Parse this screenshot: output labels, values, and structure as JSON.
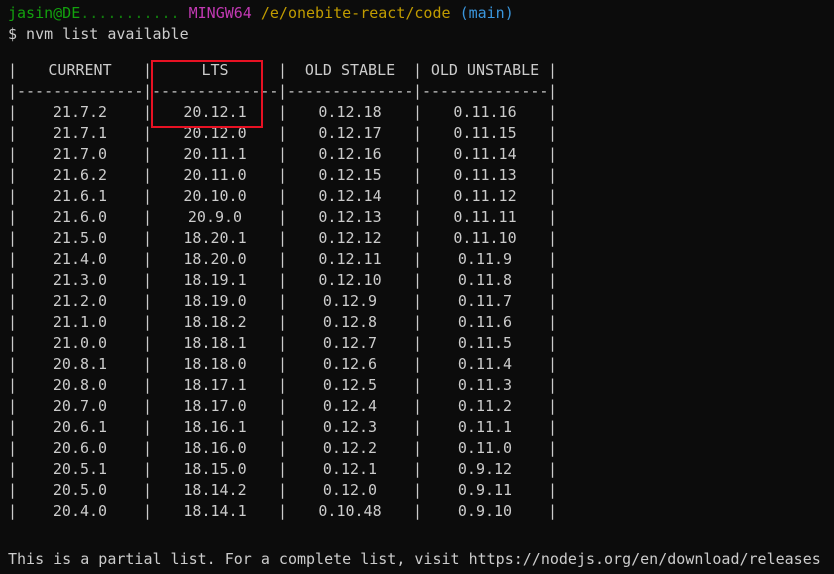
{
  "prompt": {
    "user_host": "jasin@DE",
    "host_obscured": "...........",
    "mingw": "MINGW64",
    "path": "/e/onebite-react/code",
    "branch": "(main)"
  },
  "command": "$ nvm list available",
  "table": {
    "headers": [
      "CURRENT",
      "LTS",
      "OLD STABLE",
      "OLD UNSTABLE"
    ],
    "divider": "--------------",
    "rows": [
      [
        "21.7.2",
        "20.12.1",
        "0.12.18",
        "0.11.16"
      ],
      [
        "21.7.1",
        "20.12.0",
        "0.12.17",
        "0.11.15"
      ],
      [
        "21.7.0",
        "20.11.1",
        "0.12.16",
        "0.11.14"
      ],
      [
        "21.6.2",
        "20.11.0",
        "0.12.15",
        "0.11.13"
      ],
      [
        "21.6.1",
        "20.10.0",
        "0.12.14",
        "0.11.12"
      ],
      [
        "21.6.0",
        "20.9.0",
        "0.12.13",
        "0.11.11"
      ],
      [
        "21.5.0",
        "18.20.1",
        "0.12.12",
        "0.11.10"
      ],
      [
        "21.4.0",
        "18.20.0",
        "0.12.11",
        "0.11.9"
      ],
      [
        "21.3.0",
        "18.19.1",
        "0.12.10",
        "0.11.8"
      ],
      [
        "21.2.0",
        "18.19.0",
        "0.12.9",
        "0.11.7"
      ],
      [
        "21.1.0",
        "18.18.2",
        "0.12.8",
        "0.11.6"
      ],
      [
        "21.0.0",
        "18.18.1",
        "0.12.7",
        "0.11.5"
      ],
      [
        "20.8.1",
        "18.18.0",
        "0.12.6",
        "0.11.4"
      ],
      [
        "20.8.0",
        "18.17.1",
        "0.12.5",
        "0.11.3"
      ],
      [
        "20.7.0",
        "18.17.0",
        "0.12.4",
        "0.11.2"
      ],
      [
        "20.6.1",
        "18.16.1",
        "0.12.3",
        "0.11.1"
      ],
      [
        "20.6.0",
        "18.16.0",
        "0.12.2",
        "0.11.0"
      ],
      [
        "20.5.1",
        "18.15.0",
        "0.12.1",
        "0.9.12"
      ],
      [
        "20.5.0",
        "18.14.2",
        "0.12.0",
        "0.9.11"
      ],
      [
        "20.4.0",
        "18.14.1",
        "0.10.48",
        "0.9.10"
      ]
    ]
  },
  "footer": "This is a partial list. For a complete list, visit https://nodejs.org/en/download/releases",
  "colors": {
    "background": "#0c0c0c",
    "text": "#cccccc",
    "user": "#13a10e",
    "mingw": "#c239b3",
    "path": "#c19c00",
    "branch": "#3a96dd",
    "highlight": "#e81123"
  }
}
